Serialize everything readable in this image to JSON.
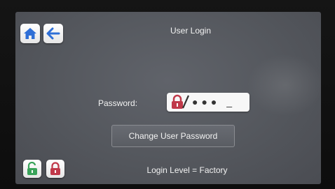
{
  "header": {
    "title": "User Login",
    "home_icon": "home-icon",
    "back_icon": "back-arrow-icon"
  },
  "login": {
    "password_label": "Password:",
    "password_mask": "●●● _",
    "lock_icon": "locked-padlock-icon"
  },
  "actions": {
    "change_password_label": "Change User Password"
  },
  "footer": {
    "login_level_text": "Login Level = Factory",
    "unlock_icon": "unlocked-padlock-icon",
    "lock_icon": "locked-padlock-icon"
  },
  "colors": {
    "icon_blue": "#2f6fd6",
    "lock_red": "#c0394a",
    "lock_green": "#3aa35a",
    "screen_bg": "#56595f"
  }
}
